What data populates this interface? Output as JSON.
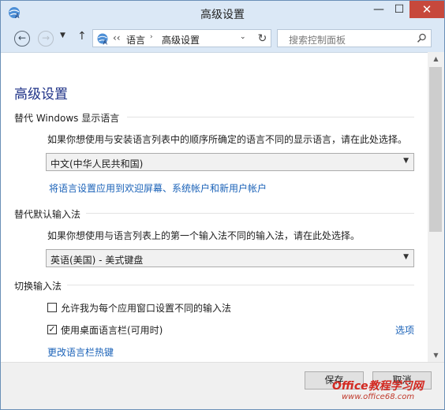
{
  "window": {
    "title": "高级设置"
  },
  "titlebar_buttons": {
    "minimize": "—",
    "maximize": "☐",
    "close": "✕"
  },
  "nav": {
    "back_glyph": "←",
    "forward_glyph": "→",
    "dropdown_glyph": "▼",
    "up_glyph": "↑",
    "breadcrumb_sep": "‹‹",
    "breadcrumbs": [
      "语言",
      "高级设置"
    ],
    "crumb_arrow": "›",
    "address_dropdown_glyph": "⌄",
    "refresh_glyph": "↻"
  },
  "search": {
    "placeholder": "搜索控制面板"
  },
  "page": {
    "title": "高级设置"
  },
  "display_language": {
    "heading": "替代 Windows 显示语言",
    "description": "如果你想使用与安装语言列表中的顺序所确定的语言不同的显示语言，请在此处选择。",
    "selected": "中文(中华人民共和国)",
    "apply_link": "将语言设置应用到欢迎屏幕、系统帐户和新用户帐户"
  },
  "default_input": {
    "heading": "替代默认输入法",
    "description": "如果你想使用与语言列表上的第一个输入法不同的输入法，请在此处选择。",
    "selected": "英语(美国) - 美式键盘"
  },
  "switch_input": {
    "heading": "切换输入法",
    "option1": {
      "label": "允许我为每个应用窗口设置不同的输入法",
      "checked": false
    },
    "option2": {
      "label": "使用桌面语言栏(可用时)",
      "checked": true,
      "check_glyph": "✓"
    },
    "options_link": "选项",
    "hotkeys_link": "更改语言栏热键"
  },
  "footer": {
    "save": "保存",
    "cancel": "取消"
  },
  "watermark": {
    "main": "Office教程学习网",
    "sub": "www.office68.com"
  },
  "colors": {
    "accent_title": "#1e3287",
    "link": "#1a62b8",
    "close_button": "#c7483c",
    "frame": "#dbe8f6",
    "watermark": "#d32a22"
  }
}
